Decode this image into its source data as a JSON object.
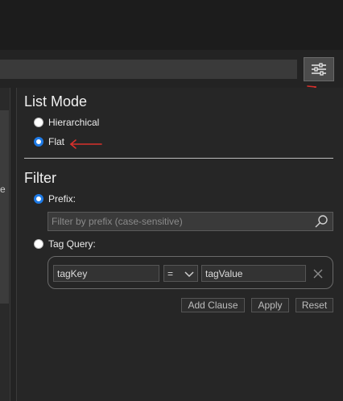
{
  "list_mode": {
    "title": "List Mode",
    "options": [
      {
        "label": "Hierarchical",
        "selected": false
      },
      {
        "label": "Flat",
        "selected": true
      }
    ]
  },
  "filter": {
    "title": "Filter",
    "prefix": {
      "label": "Prefix:",
      "selected": true,
      "placeholder": "Filter by prefix (case-sensitive)"
    },
    "tag_query": {
      "label": "Tag Query:",
      "selected": false,
      "key_value": "tagKey",
      "operator": "=",
      "value_value": "tagValue"
    },
    "buttons": {
      "add_clause": "Add Clause",
      "apply": "Apply",
      "reset": "Reset"
    }
  },
  "left_panel": {
    "edge_text": "e"
  },
  "colors": {
    "accent": "#1e7ae6",
    "annotation_arrow": "#d9302c"
  },
  "icons": [
    "settings-sliders-icon",
    "search-icon",
    "close-icon",
    "chevron-down-icon",
    "annotation-arrow"
  ]
}
